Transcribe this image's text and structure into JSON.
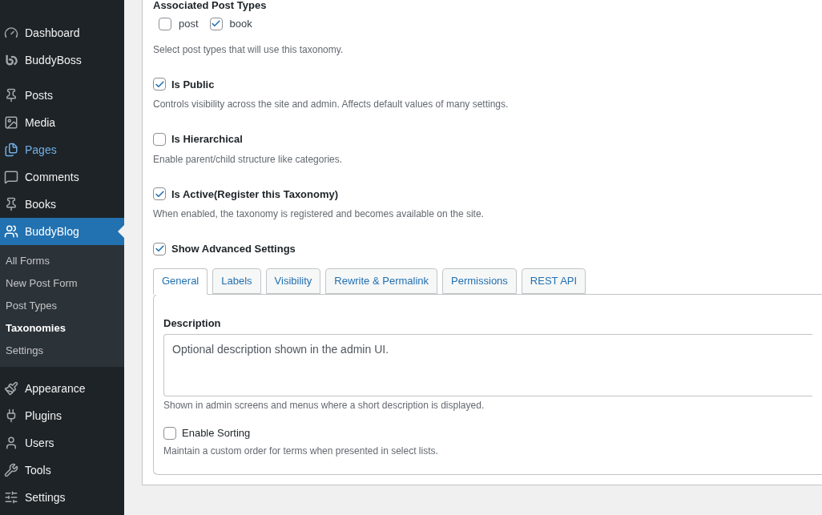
{
  "sidebar": {
    "groups": [
      {
        "items": [
          {
            "label": "Dashboard",
            "selected": false,
            "hovered": false
          },
          {
            "label": "BuddyBoss",
            "selected": false,
            "hovered": false
          }
        ]
      },
      {
        "items": [
          {
            "label": "Posts",
            "selected": false,
            "hovered": false
          },
          {
            "label": "Media",
            "selected": false,
            "hovered": false
          },
          {
            "label": "Pages",
            "selected": false,
            "hovered": true
          },
          {
            "label": "Comments",
            "selected": false,
            "hovered": false
          },
          {
            "label": "Books",
            "selected": false,
            "hovered": false
          },
          {
            "label": "BuddyBlog",
            "selected": true,
            "hovered": false,
            "children": [
              {
                "label": "All Forms",
                "selected": false
              },
              {
                "label": "New Post Form",
                "selected": false
              },
              {
                "label": "Post Types",
                "selected": false
              },
              {
                "label": "Taxonomies",
                "selected": true
              },
              {
                "label": "Settings",
                "selected": false
              }
            ]
          }
        ]
      },
      {
        "items": [
          {
            "label": "Appearance",
            "selected": false,
            "hovered": false
          },
          {
            "label": "Plugins",
            "selected": false,
            "hovered": false
          },
          {
            "label": "Users",
            "selected": false,
            "hovered": false
          },
          {
            "label": "Tools",
            "selected": false,
            "hovered": false
          },
          {
            "label": "Settings",
            "selected": false,
            "hovered": false
          }
        ]
      }
    ]
  },
  "post_types": {
    "heading": "Associated Post Types",
    "options": [
      {
        "label": "post",
        "checked": false
      },
      {
        "label": "book",
        "checked": true
      }
    ],
    "help": "Select post types that will use this taxonomy."
  },
  "toggles": [
    {
      "label": "Is Public",
      "checked": true,
      "help": "Controls visibility across the site and admin. Affects default values of many settings."
    },
    {
      "label": "Is Hierarchical",
      "checked": false,
      "help": "Enable parent/child structure like categories."
    },
    {
      "label": "Is Active(Register this Taxonomy)",
      "checked": true,
      "help": "When enabled, the taxonomy is registered and becomes available on the site."
    }
  ],
  "advanced": {
    "label": "Show Advanced Settings",
    "checked": true
  },
  "tabs": [
    {
      "label": "General",
      "selected": true
    },
    {
      "label": "Labels",
      "selected": false
    },
    {
      "label": "Visibility",
      "selected": false
    },
    {
      "label": "Rewrite & Permalink",
      "selected": false
    },
    {
      "label": "Permissions",
      "selected": false
    },
    {
      "label": "REST API",
      "selected": false
    }
  ],
  "general": {
    "description": {
      "label": "Description",
      "placeholder": "Optional description shown in the admin UI.",
      "help": "Shown in admin screens and menus where a short description is displayed."
    },
    "sorting": {
      "label": "Enable Sorting",
      "checked": false,
      "help": "Maintain a custom order for terms when presented in select lists."
    }
  }
}
